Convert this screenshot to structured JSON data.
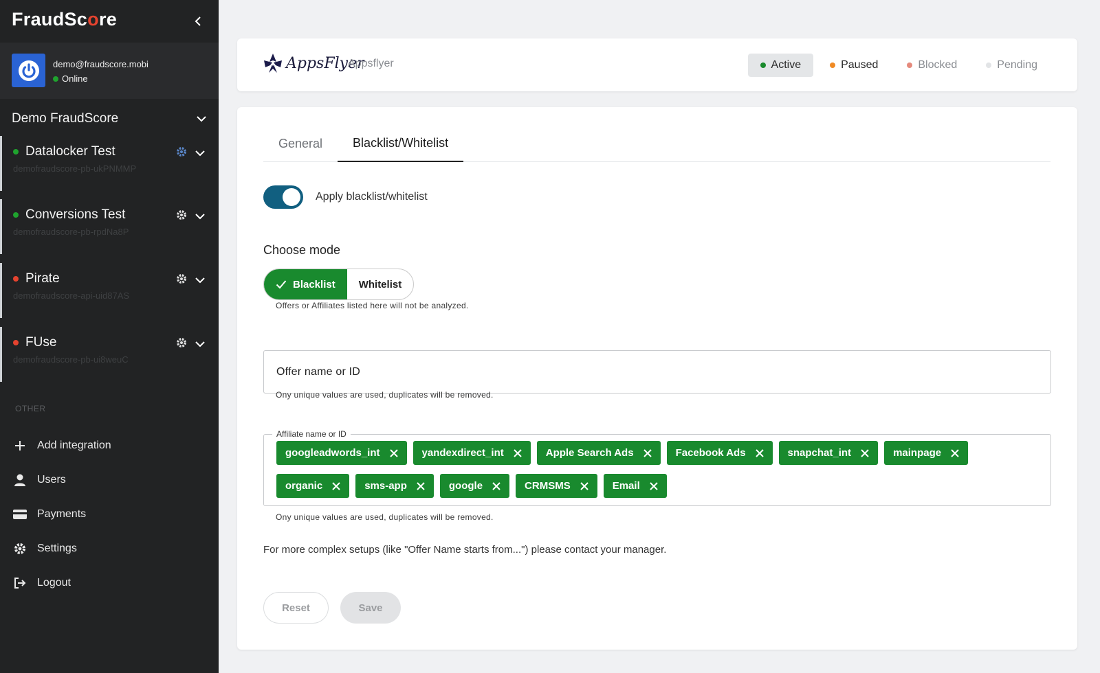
{
  "sidebar": {
    "brand_prefix": "FraudSc",
    "brand_o": "o",
    "brand_suffix": "re",
    "user": {
      "email": "demo@fraudscore.mobi",
      "status": "Online"
    },
    "org_name": "Demo FraudScore",
    "projects": [
      {
        "name": "Datalocker Test",
        "id": "demofraudscore-pb-ukPNMMP",
        "status_color": "#1fa32e"
      },
      {
        "name": "Conversions Test",
        "id": "demofraudscore-pb-rpdNa8P",
        "status_color": "#1fa32e"
      },
      {
        "name": "Pirate",
        "id": "demofraudscore-api-uid87AS",
        "status_color": "#e5432f"
      },
      {
        "name": "FUse",
        "id": "demofraudscore-pb-ui8weuC",
        "status_color": "#e5432f"
      }
    ],
    "other_label": "OTHER",
    "nav": [
      {
        "label": "Add integration",
        "icon": "plus-icon"
      },
      {
        "label": "Users",
        "icon": "user-icon"
      },
      {
        "label": "Payments",
        "icon": "credit-card-icon"
      },
      {
        "label": "Settings",
        "icon": "gear-icon"
      },
      {
        "label": "Logout",
        "icon": "logout-icon"
      }
    ]
  },
  "header": {
    "logo_text": "AppsFlyer",
    "integration_name": "Appsflyer",
    "statuses": [
      {
        "label": "Active",
        "color": "#1a8a2c",
        "selected": true
      },
      {
        "label": "Paused",
        "color": "#f08a24",
        "selected": false
      },
      {
        "label": "Blocked",
        "color": "#e58a7c",
        "selected": false
      },
      {
        "label": "Pending",
        "color": "#e2e4e6",
        "selected": false
      }
    ]
  },
  "main": {
    "tabs": [
      {
        "label": "General",
        "active": false
      },
      {
        "label": "Blacklist/Whitelist",
        "active": true
      }
    ],
    "toggle_label": "Apply blacklist/whitelist",
    "toggle_on": true,
    "mode_title": "Choose mode",
    "modes": [
      {
        "label": "Blacklist",
        "selected": true
      },
      {
        "label": "Whitelist",
        "selected": false
      }
    ],
    "mode_hint": "Offers or Affiliates listed here will not be analyzed.",
    "offer_placeholder": "Offer name or ID",
    "offer_hint": "Ony unique values are used, duplicates will be removed.",
    "affiliate_label": "Affiliate name or ID",
    "affiliate_chips": [
      "googleadwords_int",
      "yandexdirect_int",
      "Apple Search Ads",
      "Facebook Ads",
      "snapchat_int",
      "mainpage",
      "organic",
      "sms-app",
      "google",
      "CRMSMS",
      "Email"
    ],
    "affiliate_hint": "Ony unique values are used, duplicates will be removed.",
    "note": "For more complex setups (like \"Offer Name starts from...\") please contact your manager.",
    "reset_label": "Reset",
    "save_label": "Save"
  }
}
